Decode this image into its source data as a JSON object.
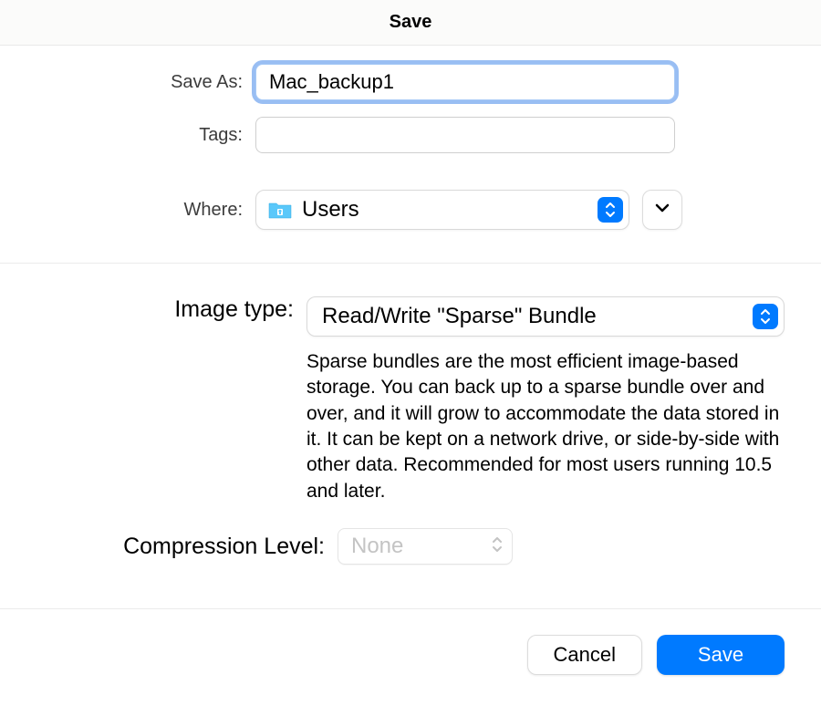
{
  "title": "Save",
  "form": {
    "save_as_label": "Save As:",
    "save_as_value": "Mac_backup1",
    "tags_label": "Tags:",
    "tags_value": "",
    "where_label": "Where:",
    "where_value": "Users"
  },
  "image_type": {
    "label": "Image type:",
    "value": "Read/Write \"Sparse\" Bundle",
    "description": "Sparse bundles are the most efficient image-based storage.  You can back up to a sparse bundle over and over, and it will grow to accommodate the data stored in it. It can be kept on a network drive, or side-by-side with other data. Recommended for most users running 10.5 and later."
  },
  "compression": {
    "label": "Compression Level:",
    "value": "None"
  },
  "footer": {
    "cancel_label": "Cancel",
    "save_label": "Save"
  }
}
